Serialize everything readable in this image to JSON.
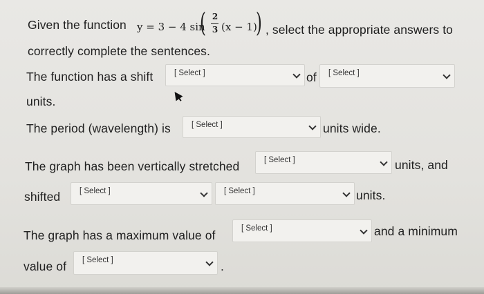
{
  "question": {
    "intro_prefix": "Given the function",
    "formula_lhs": "y = 3 − 4 sin",
    "frac_num": "2",
    "frac_den": "3",
    "formula_arg": "(x − 1)",
    "intro_suffix": ", select the appropriate answers to",
    "intro_line2": "correctly complete the sentences."
  },
  "sentences": {
    "shift_prefix": "The function has a shift",
    "shift_of": "of",
    "units": "units.",
    "period_prefix": "The period (wavelength) is",
    "period_suffix": "units wide.",
    "stretch_prefix": "The graph has been vertically stretched",
    "stretch_suffix": "units, and",
    "shifted": "shifted",
    "shifted_suffix": "units.",
    "max_prefix": "The graph has a maximum value of",
    "max_suffix": "and a minimum",
    "min_prefix": "value of",
    "min_suffix": "."
  },
  "dropdowns": {
    "shift_direction": "[ Select ]",
    "shift_amount": "[ Select ]",
    "period": "[ Select ]",
    "stretch": "[ Select ]",
    "vshift_direction": "[ Select ]",
    "vshift_amount": "[ Select ]",
    "maximum": "[ Select ]",
    "minimum": "[ Select ]"
  },
  "icons": {
    "dropdown": "chevron-down-icon",
    "cursor": "mouse-pointer-icon"
  }
}
